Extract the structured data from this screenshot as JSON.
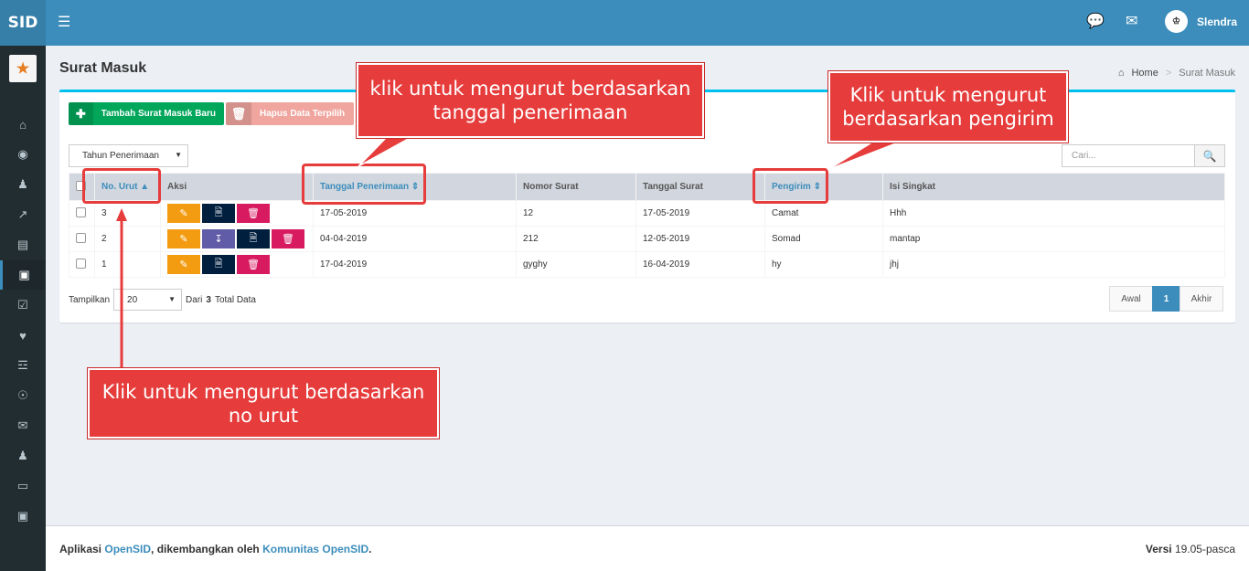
{
  "app": {
    "logo": "SID",
    "user": "Slendra"
  },
  "page": {
    "title": "Surat Masuk",
    "breadcrumb": [
      "Home",
      "Surat Masuk"
    ]
  },
  "toolbar": {
    "add": "Tambah Surat Masuk Baru",
    "delete": "Hapus Data Terpilih"
  },
  "filter": {
    "year_placeholder": "Tahun Penerimaan",
    "search_placeholder": "Cari..."
  },
  "table": {
    "headers": {
      "no": "No. Urut",
      "aksi": "Aksi",
      "tgl": "Tanggal Penerimaan",
      "nomor": "Nomor Surat",
      "tgl_surat": "Tanggal Surat",
      "pengirim": "Pengirim",
      "isi": "Isi Singkat"
    },
    "rows": [
      {
        "no": "3",
        "tgl": "17-05-2019",
        "nomor": "12",
        "tgl_surat": "17-05-2019",
        "pengirim": "Camat",
        "isi": "Hhh",
        "actions": [
          "edit",
          "doc",
          "delete"
        ]
      },
      {
        "no": "2",
        "tgl": "04-04-2019",
        "nomor": "212",
        "tgl_surat": "12-05-2019",
        "pengirim": "Somad",
        "isi": "mantap",
        "actions": [
          "edit",
          "download",
          "doc",
          "delete"
        ]
      },
      {
        "no": "1",
        "tgl": "17-04-2019",
        "nomor": "gyghy",
        "tgl_surat": "16-04-2019",
        "pengirim": "hy",
        "isi": "jhj",
        "actions": [
          "edit",
          "doc",
          "delete"
        ]
      }
    ]
  },
  "paging": {
    "show_label": "Tampilkan",
    "page_size": "20",
    "from": "Dari",
    "total": "3",
    "total_label": "Total Data",
    "first": "Awal",
    "current": "1",
    "last": "Akhir"
  },
  "footer": {
    "prefix": "Aplikasi",
    "app": "OpenSID",
    "mid": ", dikembangkan oleh",
    "org": "Komunitas OpenSID",
    "end": ".",
    "version_label": "Versi",
    "version": "19.05-pasca"
  },
  "callouts": {
    "tgl": "klik untuk mengurut berdasarkan tanggal penerimaan",
    "pengirim": "Klik untuk mengurut berdasarkan pengirim",
    "no": "Klik untuk mengurut berdasarkan no urut"
  },
  "colors": {
    "topbar": "#3c8dbc",
    "sidebar": "#222d32",
    "callout": "#e63c3c",
    "box_top": "#00c0ef"
  }
}
